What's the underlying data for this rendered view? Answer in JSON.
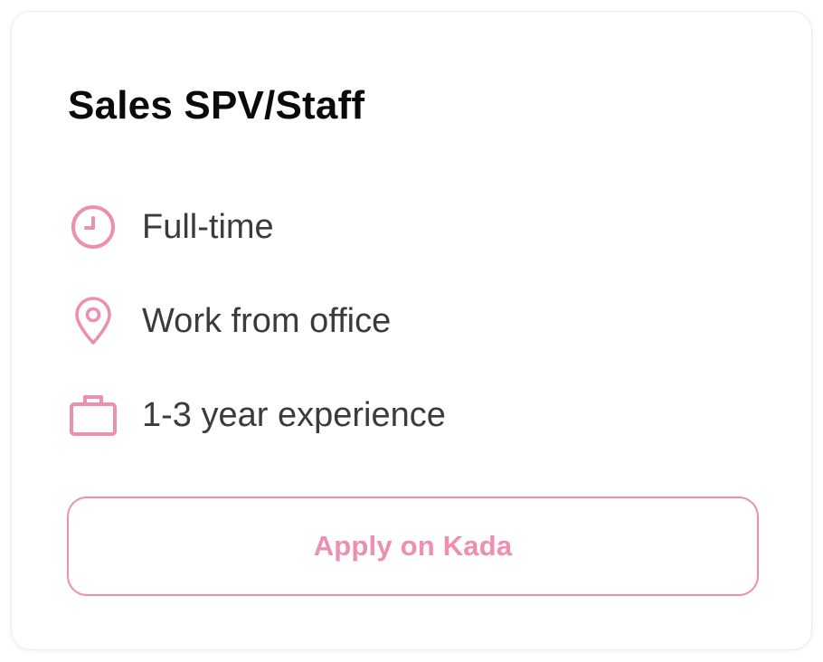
{
  "job": {
    "title": "Sales SPV/Staff",
    "details": [
      {
        "icon": "clock-icon",
        "label": "Full-time"
      },
      {
        "icon": "location-pin-icon",
        "label": "Work from office"
      },
      {
        "icon": "briefcase-icon",
        "label": "1-3 year experience"
      }
    ],
    "apply_label": "Apply on Kada"
  },
  "colors": {
    "accent": "#ec8fb0",
    "title_text": "#0a0a0a",
    "body_text": "#3b3b3b",
    "card_border": "#ececec"
  }
}
